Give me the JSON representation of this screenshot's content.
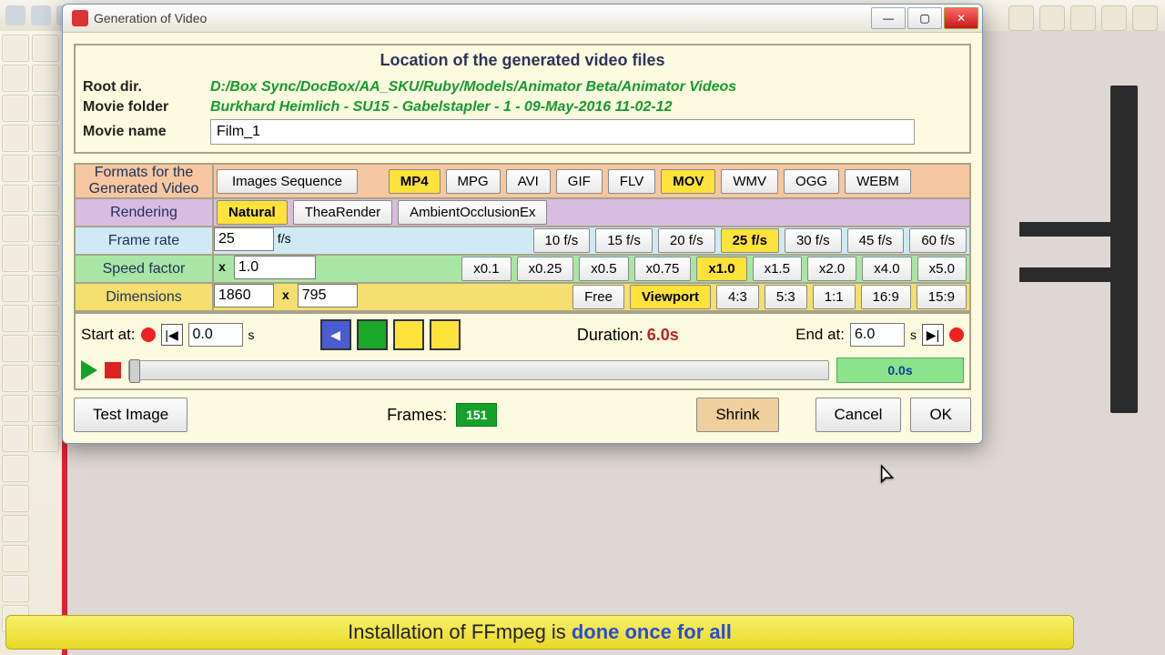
{
  "window": {
    "title": "Generation of Video"
  },
  "location_panel": {
    "heading": "Location of the generated video files",
    "root_label": "Root dir.",
    "root_value": "D:/Box Sync/DocBox/AA_SKU/Ruby/Models/Animator Beta/Animator Videos",
    "folder_label": "Movie folder",
    "folder_value": "Burkhard Heimlich - SU15 - Gabelstapler - 1 - 09-May-2016 11-02-12",
    "name_label": "Movie name",
    "name_value": "Film_1"
  },
  "formats": {
    "label": "Formats for the Generated Video",
    "images_sequence": "Images Sequence",
    "options": [
      "MP4",
      "MPG",
      "AVI",
      "GIF",
      "FLV",
      "MOV",
      "WMV",
      "OGG",
      "WEBM"
    ],
    "selected": [
      "MP4",
      "MOV"
    ]
  },
  "rendering": {
    "label": "Rendering",
    "options": [
      "Natural",
      "TheaRender",
      "AmbientOcclusionEx"
    ],
    "selected": "Natural"
  },
  "frame_rate": {
    "label": "Frame rate",
    "value": "25",
    "unit": "f/s",
    "options": [
      "10 f/s",
      "15 f/s",
      "20 f/s",
      "25 f/s",
      "30 f/s",
      "45 f/s",
      "60 f/s"
    ],
    "selected": "25 f/s"
  },
  "speed": {
    "label": "Speed factor",
    "prefix": "x",
    "value": "1.0",
    "options": [
      "x0.1",
      "x0.25",
      "x0.5",
      "x0.75",
      "x1.0",
      "x1.5",
      "x2.0",
      "x4.0",
      "x5.0"
    ],
    "selected": "x1.0"
  },
  "dimensions": {
    "label": "Dimensions",
    "w": "1860",
    "h": "795",
    "x": "x",
    "options": [
      "Free",
      "Viewport",
      "4:3",
      "5:3",
      "1:1",
      "16:9",
      "15:9"
    ],
    "selected": "Viewport"
  },
  "timeline": {
    "start_label": "Start at:",
    "start_value": "0.0",
    "start_unit": "s",
    "duration_label": "Duration:",
    "duration_value": "6.0s",
    "end_label": "End at:",
    "end_value": "6.0",
    "end_unit": "s",
    "readout": "0.0s"
  },
  "bottom": {
    "test_image": "Test Image",
    "frames_label": "Frames:",
    "frames_value": "151",
    "shrink": "Shrink",
    "cancel": "Cancel",
    "ok": "OK"
  },
  "banner": {
    "prefix": "Installation of FFmpeg is ",
    "emphasis": "done once for all"
  }
}
